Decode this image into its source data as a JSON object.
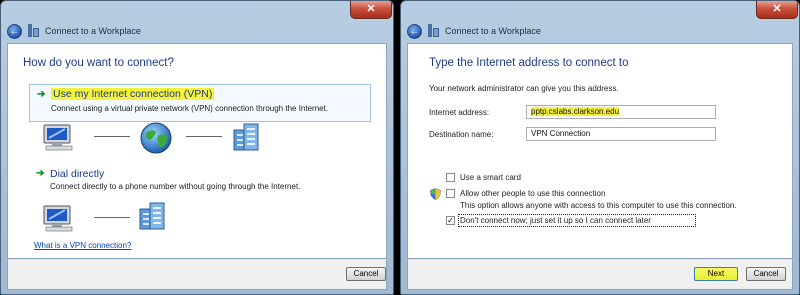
{
  "window1": {
    "title": "Connect to a Workplace",
    "heading": "How do you want to connect?",
    "option_vpn": {
      "title": "Use my Internet connection (VPN)",
      "desc": "Connect using a virtual private network (VPN) connection through the Internet."
    },
    "option_dial": {
      "title": "Dial directly",
      "desc": "Connect directly to a phone number without going through the Internet."
    },
    "link": "What is a VPN connection?",
    "cancel_label": "Cancel"
  },
  "window2": {
    "title": "Connect to a Workplace",
    "heading": "Type the Internet address to connect to",
    "subtext": "Your network administrator can give you this address.",
    "internet_address_label": "Internet address:",
    "internet_address_value": "pptp.cslabs.clarkson.edu",
    "destination_label": "Destination name:",
    "destination_value": "VPN Connection",
    "smart_card_label": "Use a smart card",
    "allow_others_label": "Allow other people to use this connection",
    "allow_others_desc": "This option allows anyone with access to this computer to use this connection.",
    "dont_connect_label": "Don't connect now; just set it up so I can connect later",
    "next_label": "Next",
    "cancel_label": "Cancel"
  },
  "colors": {
    "highlight": "#f3f13a",
    "heading": "#1a3a8b",
    "arrow": "#138a2c",
    "link": "#0645ad"
  },
  "icons": [
    "back-arrow-icon",
    "wizard-icon",
    "close-icon",
    "computer-icon",
    "globe-icon",
    "server-icon",
    "green-arrow-icon",
    "shield-icon"
  ]
}
